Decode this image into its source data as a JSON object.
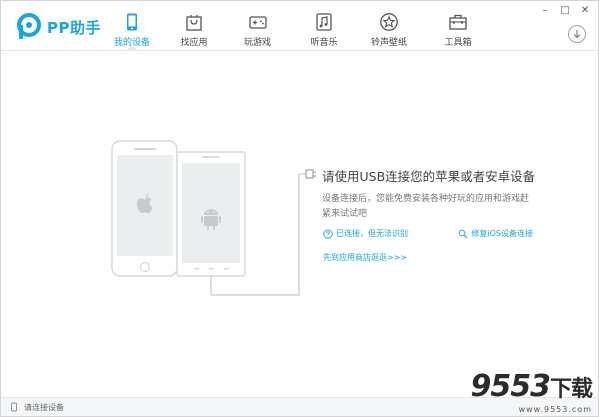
{
  "app": {
    "logo_text": "PP助手",
    "brand_color": "#18a6e0"
  },
  "nav": {
    "items": [
      {
        "label": "我的设备",
        "icon": "phone-icon",
        "active": true
      },
      {
        "label": "找应用",
        "icon": "shopping-bag-icon",
        "active": false
      },
      {
        "label": "玩游戏",
        "icon": "gamepad-icon",
        "active": false
      },
      {
        "label": "听音乐",
        "icon": "music-icon",
        "active": false
      },
      {
        "label": "铃声壁纸",
        "icon": "star-icon",
        "active": false
      },
      {
        "label": "工具箱",
        "icon": "toolbox-icon",
        "active": false
      }
    ]
  },
  "window_controls": {
    "minimize": "–",
    "maximize": "□",
    "close": "✕"
  },
  "main": {
    "title": "请使用USB连接您的苹果或者安卓设备",
    "description": "设备连接后，您能免费安装各种好玩的应用和游戏赶紧来试试吧",
    "link_connected_unrecognized": "已连接，但无法识别",
    "link_fix_ios": "修复iOS设备连接",
    "link_store": "先到应用商店逛逛>>>"
  },
  "statusbar": {
    "text": "请连接设备"
  },
  "watermark": {
    "main": "9553",
    "main_suffix": "下载",
    "sub": "www.9553.com"
  }
}
